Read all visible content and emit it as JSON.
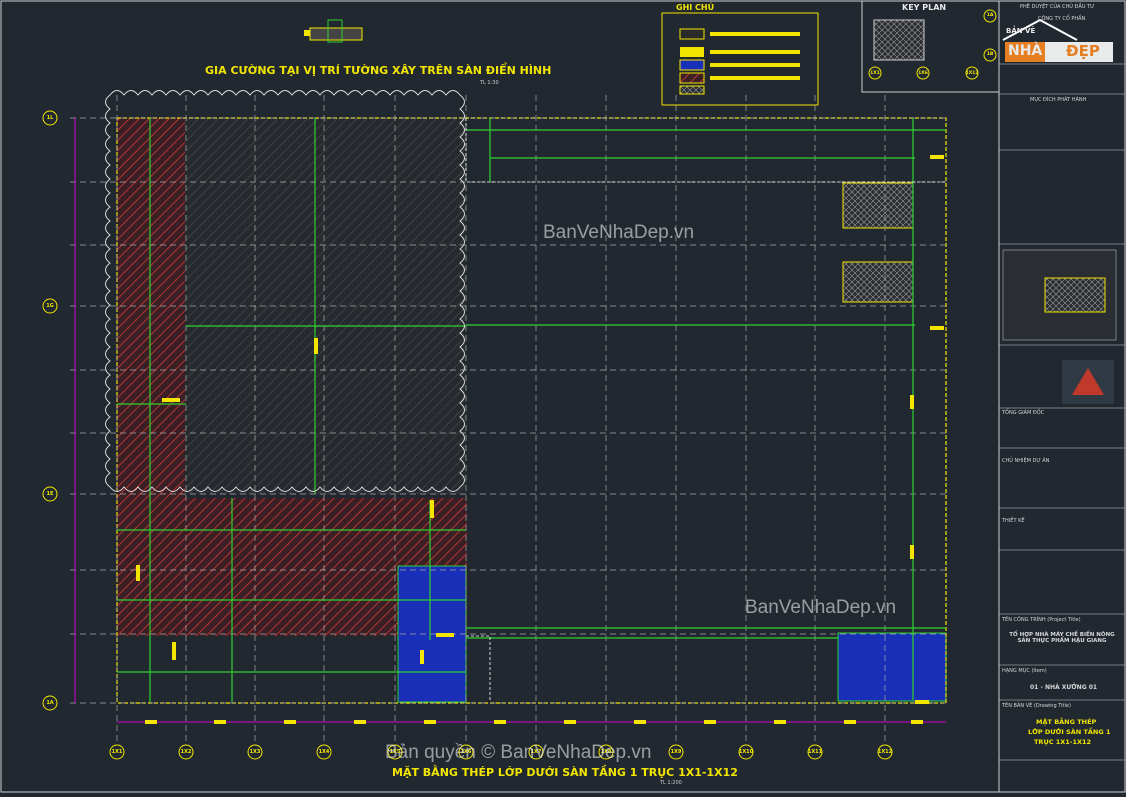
{
  "drawing": {
    "detail_title": "GIA CƯỜNG TẠI VỊ TRÍ TƯỜNG XÂY TRÊN SÀN ĐIỂN HÌNH",
    "detail_scale": "TL 1:30",
    "main_title": "MẶT BẰNG THÉP LỚP DƯỚI SÀN TẦNG 1 TRỤC 1X1-1X12",
    "main_scale": "TL 1:200",
    "legend_title": "GHI CHÚ",
    "keyplan_title": "KEY PLAN",
    "column_axes": [
      "1X1",
      "1X2",
      "1X3",
      "1X4",
      "1X5",
      "1X6",
      "1X7",
      "1X8",
      "1X9",
      "1X10",
      "1X11",
      "1X12"
    ],
    "row_axes": [
      "1L",
      "1G",
      "1E",
      "1A"
    ],
    "keyplan_axes_top": [
      "1X1",
      "1X6",
      "1X12"
    ],
    "keyplan_axes_side": [
      "1A",
      "1B"
    ]
  },
  "watermarks": {
    "mid1": "BanVeNhaDep.vn",
    "mid2": "BanVeNhaDep.vn",
    "bottom": "Bản quyền © BanVeNhaDep.vn"
  },
  "logo": {
    "top": "BẢN VẼ",
    "left": "NHÀ",
    "right": "ĐẸP"
  },
  "title_block": {
    "approved": "PHÊ DUYỆT CỦA CHỦ ĐẦU TƯ",
    "owner": "CÔNG TY CỔ PHẦN",
    "revision": "MỤC ĐÍCH PHÁT HÀNH",
    "director": "TỔNG GIÁM ĐỐC",
    "pm": "CHỦ NHIỆM DỰ ÁN",
    "design": "THIẾT KẾ",
    "project_label": "TÊN CÔNG TRÌNH (Project Title)",
    "project_name": "TỔ HỢP NHÀ MÁY CHẾ BIẾN NÔNG SẢN THỰC PHẨM HẬU GIANG",
    "building_label": "HẠNG MỤC (Item)",
    "building": "01 - NHÀ XƯỞNG 01",
    "sheet_label": "TÊN BẢN VẼ (Drawing Title)",
    "sheet_title_1": "MẶT BẰNG THÉP",
    "sheet_title_2": "LỚP DƯỚI SÀN TẦNG 1",
    "sheet_title_3": "TRỤC 1X1-1X12"
  },
  "colors": {
    "background": "#212830",
    "grid_dash": "#b5b5b5",
    "green_bar": "#2fd12f",
    "hatch_red": "#d23a3a",
    "slab_blue": "#1a2fb8",
    "label_yellow": "#f2e600",
    "axis_magenta": "#d400d4",
    "cloud_white": "#dcdcdc"
  }
}
